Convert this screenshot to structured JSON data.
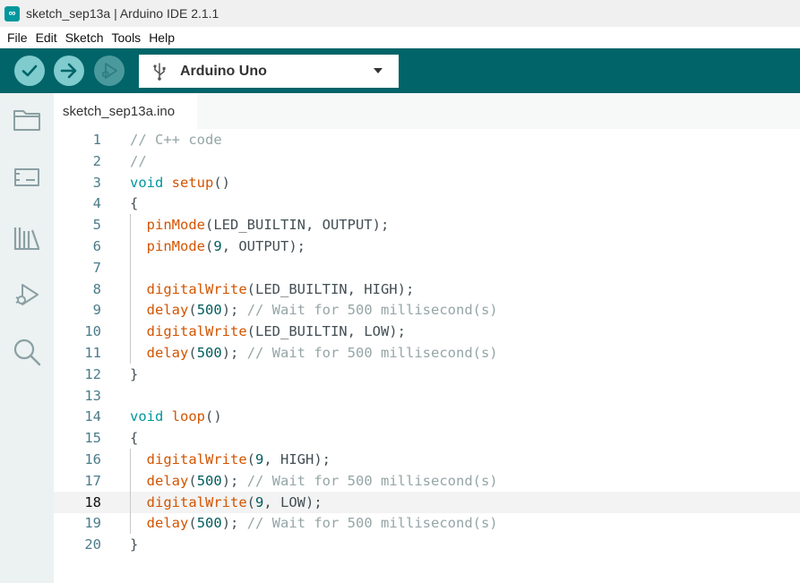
{
  "window": {
    "title": "sketch_sep13a | Arduino IDE 2.1.1"
  },
  "menu": [
    "File",
    "Edit",
    "Sketch",
    "Tools",
    "Help"
  ],
  "toolbar": {
    "board": "Arduino Uno"
  },
  "tabs": [
    {
      "label": "sketch_sep13a.ino"
    }
  ],
  "editor": {
    "current_line": 18,
    "lines": [
      {
        "n": "1",
        "tokens": [
          {
            "t": "// C++ code",
            "c": "cm"
          }
        ]
      },
      {
        "n": "2",
        "tokens": [
          {
            "t": "//",
            "c": "cm"
          }
        ]
      },
      {
        "n": "3",
        "tokens": [
          {
            "t": "void",
            "c": "kw"
          },
          {
            "t": " ",
            "c": ""
          },
          {
            "t": "setup",
            "c": "fn"
          },
          {
            "t": "()",
            "c": ""
          }
        ]
      },
      {
        "n": "4",
        "tokens": [
          {
            "t": "{",
            "c": ""
          }
        ]
      },
      {
        "n": "5",
        "tokens": [
          {
            "t": "  ",
            "c": ""
          },
          {
            "t": "pinMode",
            "c": "fn"
          },
          {
            "t": "(LED_BUILTIN, OUTPUT);",
            "c": ""
          }
        ]
      },
      {
        "n": "6",
        "tokens": [
          {
            "t": "  ",
            "c": ""
          },
          {
            "t": "pinMode",
            "c": "fn"
          },
          {
            "t": "(",
            "c": ""
          },
          {
            "t": "9",
            "c": "num"
          },
          {
            "t": ", OUTPUT);",
            "c": ""
          }
        ]
      },
      {
        "n": "7",
        "tokens": []
      },
      {
        "n": "8",
        "tokens": [
          {
            "t": "  ",
            "c": ""
          },
          {
            "t": "digitalWrite",
            "c": "fn"
          },
          {
            "t": "(LED_BUILTIN, HIGH);",
            "c": ""
          }
        ]
      },
      {
        "n": "9",
        "tokens": [
          {
            "t": "  ",
            "c": ""
          },
          {
            "t": "delay",
            "c": "fn"
          },
          {
            "t": "(",
            "c": ""
          },
          {
            "t": "500",
            "c": "num"
          },
          {
            "t": "); ",
            "c": ""
          },
          {
            "t": "// Wait for 500 millisecond(s)",
            "c": "cm"
          }
        ]
      },
      {
        "n": "10",
        "tokens": [
          {
            "t": "  ",
            "c": ""
          },
          {
            "t": "digitalWrite",
            "c": "fn"
          },
          {
            "t": "(LED_BUILTIN, LOW);",
            "c": ""
          }
        ]
      },
      {
        "n": "11",
        "tokens": [
          {
            "t": "  ",
            "c": ""
          },
          {
            "t": "delay",
            "c": "fn"
          },
          {
            "t": "(",
            "c": ""
          },
          {
            "t": "500",
            "c": "num"
          },
          {
            "t": "); ",
            "c": ""
          },
          {
            "t": "// Wait for 500 millisecond(s)",
            "c": "cm"
          }
        ]
      },
      {
        "n": "12",
        "tokens": [
          {
            "t": "}",
            "c": ""
          }
        ]
      },
      {
        "n": "13",
        "tokens": []
      },
      {
        "n": "14",
        "tokens": [
          {
            "t": "void",
            "c": "kw"
          },
          {
            "t": " ",
            "c": ""
          },
          {
            "t": "loop",
            "c": "fn"
          },
          {
            "t": "()",
            "c": ""
          }
        ]
      },
      {
        "n": "15",
        "tokens": [
          {
            "t": "{",
            "c": ""
          }
        ]
      },
      {
        "n": "16",
        "tokens": [
          {
            "t": "  ",
            "c": ""
          },
          {
            "t": "digitalWrite",
            "c": "fn"
          },
          {
            "t": "(",
            "c": ""
          },
          {
            "t": "9",
            "c": "num"
          },
          {
            "t": ", HIGH);",
            "c": ""
          }
        ]
      },
      {
        "n": "17",
        "tokens": [
          {
            "t": "  ",
            "c": ""
          },
          {
            "t": "delay",
            "c": "fn"
          },
          {
            "t": "(",
            "c": ""
          },
          {
            "t": "500",
            "c": "num"
          },
          {
            "t": "); ",
            "c": ""
          },
          {
            "t": "// Wait for 500 millisecond(s)",
            "c": "cm"
          }
        ]
      },
      {
        "n": "18",
        "tokens": [
          {
            "t": "  ",
            "c": ""
          },
          {
            "t": "digitalWrite",
            "c": "fn"
          },
          {
            "t": "(",
            "c": ""
          },
          {
            "t": "9",
            "c": "num"
          },
          {
            "t": ", LOW);",
            "c": ""
          }
        ]
      },
      {
        "n": "19",
        "tokens": [
          {
            "t": "  ",
            "c": ""
          },
          {
            "t": "delay",
            "c": "fn"
          },
          {
            "t": "(",
            "c": ""
          },
          {
            "t": "500",
            "c": "num"
          },
          {
            "t": "); ",
            "c": ""
          },
          {
            "t": "// Wait for 500 millisecond(s)",
            "c": "cm"
          }
        ]
      },
      {
        "n": "20",
        "tokens": [
          {
            "t": "}",
            "c": ""
          }
        ]
      }
    ]
  },
  "icons": {
    "app": "arduino-infinity-icon",
    "verify": "checkmark-icon",
    "upload": "arrow-right-icon",
    "debug": "debug-icon",
    "board_port": "usb-icon",
    "dropdown": "chevron-down-icon",
    "sidebar": [
      "folder-icon",
      "board-manager-icon",
      "library-icon",
      "debug-icon",
      "search-icon"
    ]
  },
  "colors": {
    "accent": "#006468",
    "teal": "#00979d",
    "button": "#7fcbcd"
  }
}
